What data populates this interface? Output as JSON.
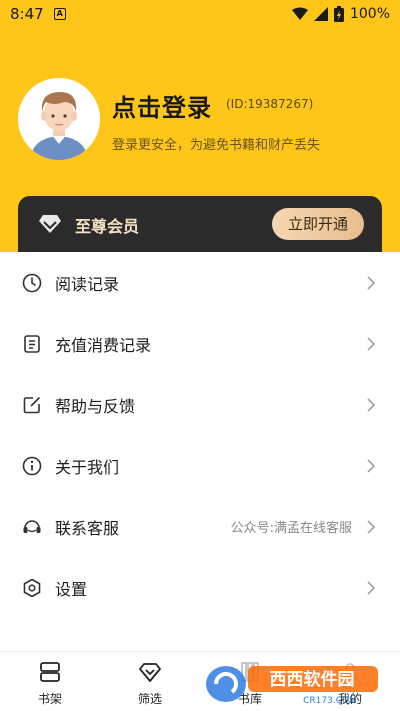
{
  "status_bar": {
    "time": "8:47",
    "app_icon_letter": "A",
    "battery_percent": "100%"
  },
  "profile": {
    "login_title": "点击登录",
    "user_id": "(ID:19387267)",
    "subtitle": "登录更安全，为避免书籍和财产丢失"
  },
  "vip": {
    "label": "至尊会员",
    "button_label": "立即开通"
  },
  "menu": {
    "items": [
      {
        "label": "阅读记录",
        "icon": "clock-icon"
      },
      {
        "label": "充值消费记录",
        "icon": "receipt-icon"
      },
      {
        "label": "帮助与反馈",
        "icon": "edit-icon"
      },
      {
        "label": "关于我们",
        "icon": "info-icon"
      },
      {
        "label": "联系客服",
        "icon": "headset-icon",
        "extra": "公众号:满孟在线客服"
      },
      {
        "label": "设置",
        "icon": "settings-icon"
      }
    ]
  },
  "bottom_nav": {
    "items": [
      {
        "label": "书架",
        "icon": "bookshelf-icon"
      },
      {
        "label": "筛选",
        "icon": "diamond-icon"
      },
      {
        "label": "书库",
        "icon": "library-icon"
      },
      {
        "label": "我的",
        "icon": "profile-icon"
      }
    ]
  },
  "watermark": {
    "text": "西西软件园",
    "url_text": "CR173.COM"
  },
  "colors": {
    "header_yellow": "#FFC61A",
    "vip_card": "#2b2b2b",
    "vip_button_gold": "#e8bd8e"
  }
}
